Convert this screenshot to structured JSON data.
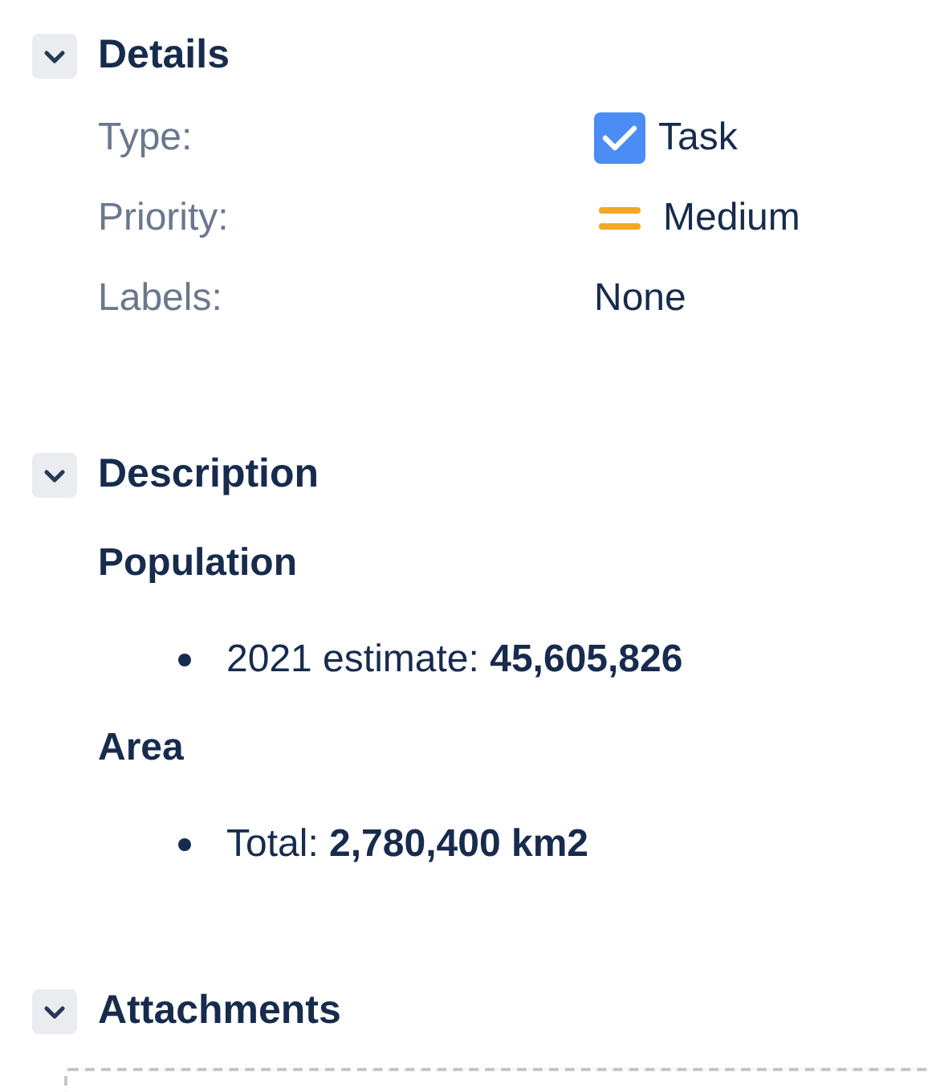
{
  "sections": [
    {
      "kind": "details",
      "title": "Details",
      "expanded": true,
      "fields": [
        {
          "label": "Type:",
          "value": "Task",
          "kind": "task"
        },
        {
          "label": "Priority:",
          "value": "Medium",
          "kind": "priority"
        },
        {
          "label": "Labels:",
          "value": "None"
        }
      ]
    },
    {
      "kind": "description",
      "title": "Description",
      "expanded": true,
      "blocks": [
        {
          "kind": "heading",
          "text": "Population"
        },
        {
          "kind": "bullet",
          "text": "2021 estimate: **45,605,826**"
        },
        {
          "kind": "heading",
          "text": "Area"
        },
        {
          "kind": "bullet",
          "text": "Total: **2,780,400 km2**"
        }
      ]
    },
    {
      "kind": "attachments",
      "title": "Attachments",
      "expanded": true
    }
  ]
}
